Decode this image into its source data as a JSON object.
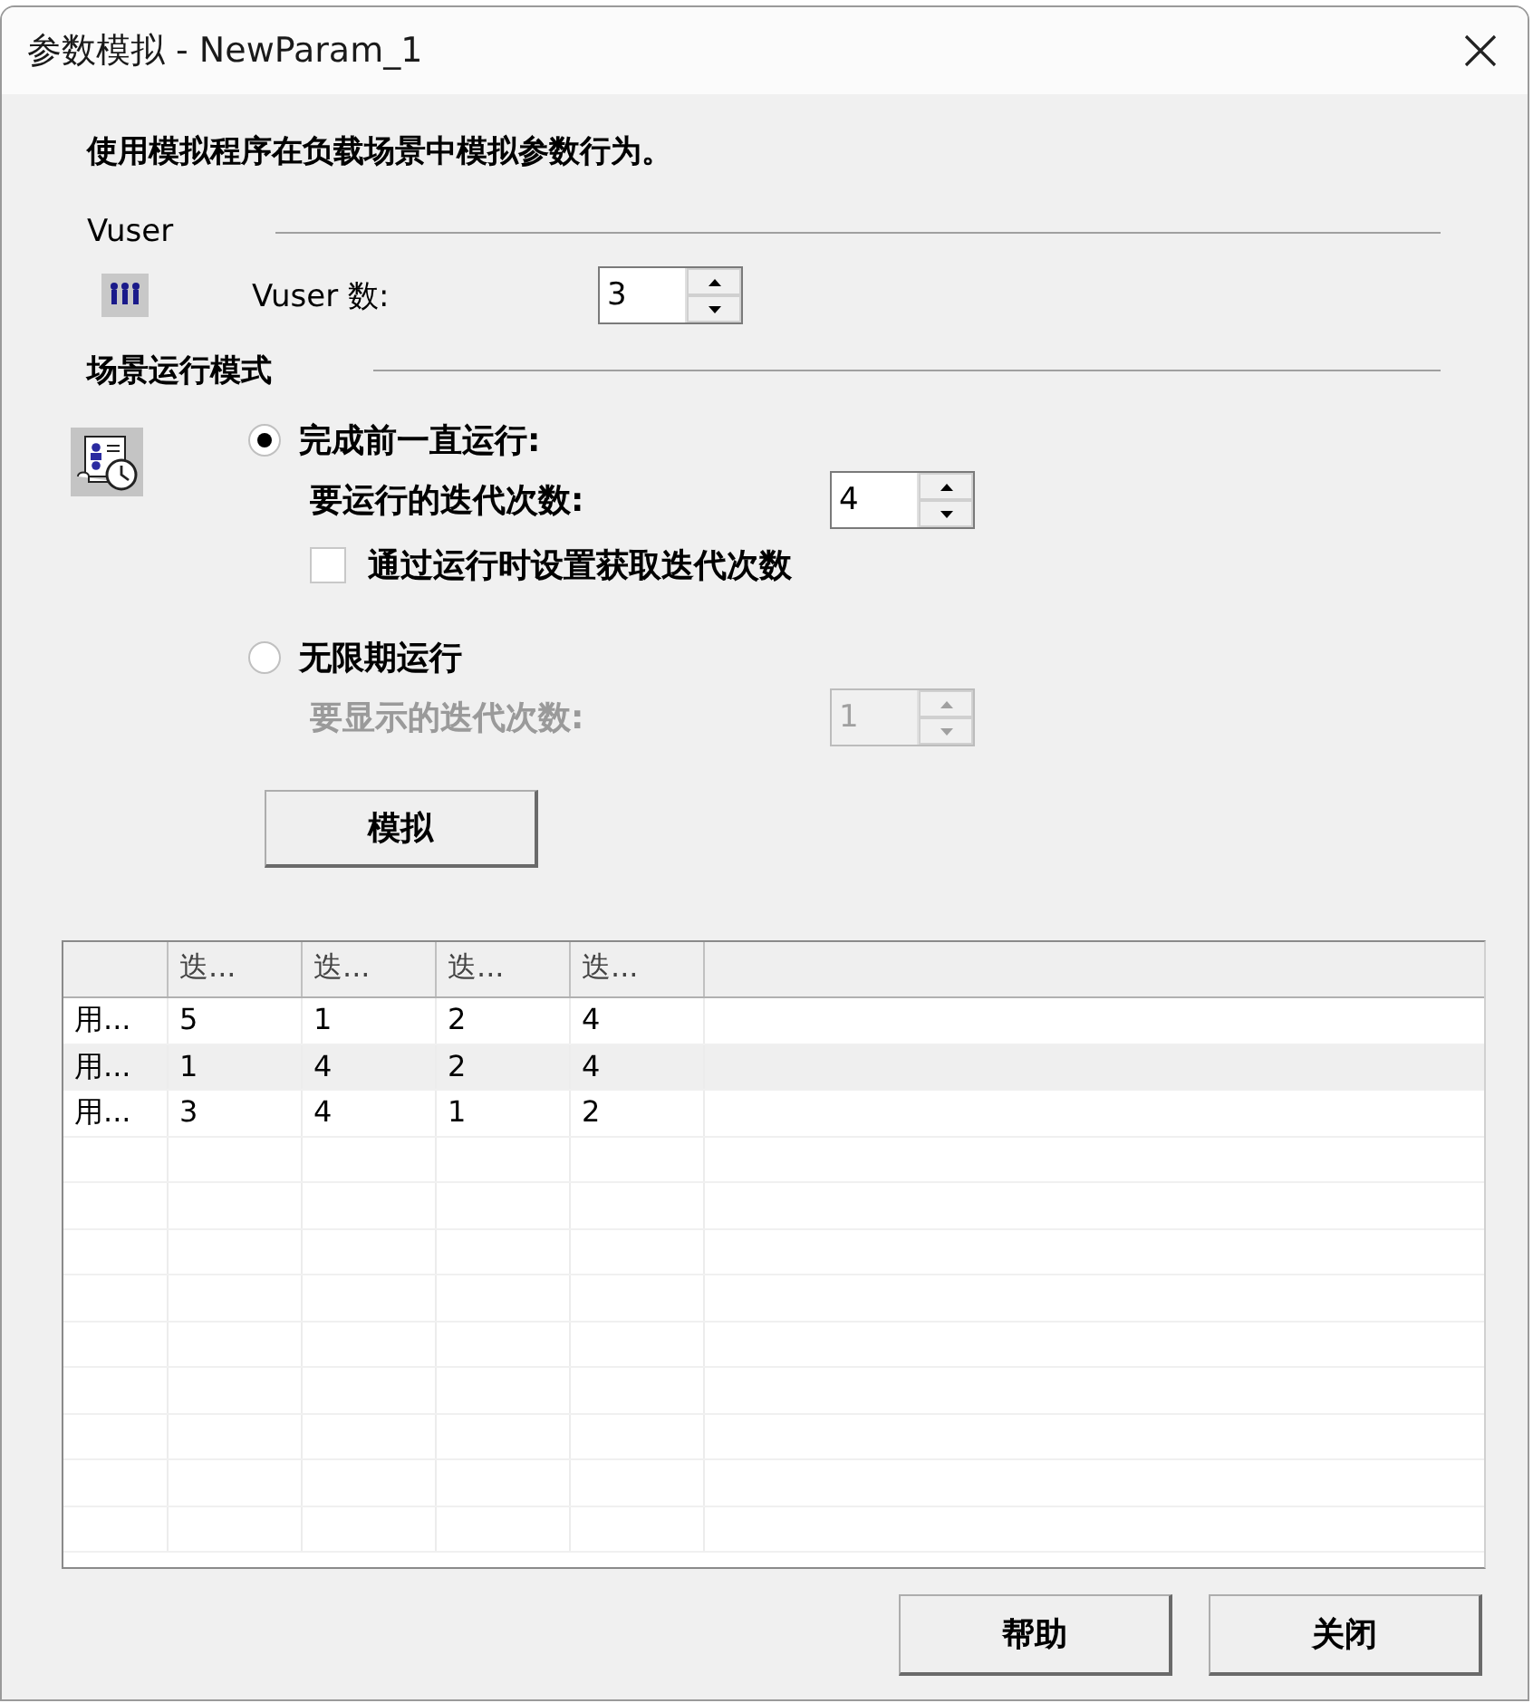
{
  "window": {
    "title": "参数模拟 - NewParam_1"
  },
  "description": "使用模拟程序在负载场景中模拟参数行为。",
  "vuser_section": {
    "heading": "Vuser",
    "label": "Vuser 数:",
    "value": "3"
  },
  "mode_section": {
    "heading": "场景运行模式",
    "options": [
      {
        "label": "完成前一直运行:",
        "selected": true,
        "count_label": "要运行的迭代次数:",
        "count_value": "4",
        "count_disabled": false,
        "checkbox": {
          "label": "通过运行时设置获取迭代次数",
          "checked": false
        }
      },
      {
        "label": "无限期运行",
        "selected": false,
        "count_label": "要显示的迭代次数:",
        "count_value": "1",
        "count_disabled": true
      }
    ]
  },
  "simulate_button": "模拟",
  "table": {
    "columns": [
      "迭...",
      "迭...",
      "迭...",
      "迭..."
    ],
    "rows": [
      {
        "label": "用...",
        "cells": [
          "5",
          "1",
          "2",
          "4"
        ],
        "selected": false
      },
      {
        "label": "用...",
        "cells": [
          "1",
          "4",
          "2",
          "4"
        ],
        "selected": true
      },
      {
        "label": "用...",
        "cells": [
          "3",
          "4",
          "1",
          "2"
        ],
        "selected": false
      }
    ]
  },
  "buttons": [
    "帮助",
    "关闭"
  ]
}
